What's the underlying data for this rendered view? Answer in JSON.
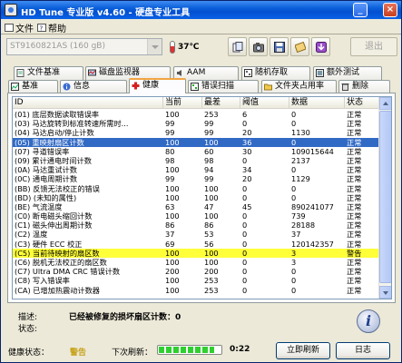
{
  "window": {
    "title": "HD Tune 专业版 v4.60 - 硬盘专业工具"
  },
  "menu": {
    "file": "文件",
    "help": "帮助"
  },
  "toolbar": {
    "disk": "ST9160821AS (160 gB)",
    "temperature": "37℃",
    "exit": "退出"
  },
  "tabs_top": [
    {
      "label": "文件基准",
      "icon": "file-icon"
    },
    {
      "label": "磁盘监视器",
      "icon": "monitor-icon"
    },
    {
      "label": "AAM",
      "icon": "speaker-icon"
    },
    {
      "label": "随机存取",
      "icon": "random-icon"
    },
    {
      "label": "额外测试",
      "icon": "extra-icon"
    }
  ],
  "tabs_bottom": [
    {
      "label": "基准",
      "icon": "benchmark-icon"
    },
    {
      "label": "信息",
      "icon": "info-icon"
    },
    {
      "label": "健康",
      "icon": "health-cross-icon"
    },
    {
      "label": "错误扫描",
      "icon": "scan-icon"
    },
    {
      "label": "文件夹占用率",
      "icon": "folder-icon"
    },
    {
      "label": "删除",
      "icon": "delete-icon"
    }
  ],
  "table": {
    "columns": [
      "ID",
      "当前",
      "最差",
      "阈值",
      "数据",
      "状态"
    ],
    "rows": [
      [
        "(01) 底层数据读取错误率",
        "100",
        "253",
        "6",
        "0",
        "正常"
      ],
      [
        "(03) 马达旋转到标准转速所需时...",
        "99",
        "99",
        "0",
        "0",
        "正常"
      ],
      [
        "(04) 马达启动/停止计数",
        "99",
        "99",
        "20",
        "1130",
        "正常"
      ],
      [
        "(05) 重映射扇区计数",
        "100",
        "100",
        "36",
        "0",
        "正常"
      ],
      [
        "(07) 寻道错误率",
        "80",
        "60",
        "30",
        "109015644",
        "正常"
      ],
      [
        "(09) 累计通电时间计数",
        "98",
        "98",
        "0",
        "2137",
        "正常"
      ],
      [
        "(0A) 马达重试计数",
        "100",
        "94",
        "34",
        "0",
        "正常"
      ],
      [
        "(0C) 通电周期计数",
        "99",
        "99",
        "20",
        "1129",
        "正常"
      ],
      [
        "(BB) 反馈无法校正的错误",
        "100",
        "100",
        "0",
        "0",
        "正常"
      ],
      [
        "(BD) (未知的属性)",
        "100",
        "100",
        "0",
        "0",
        "正常"
      ],
      [
        "(BE) 气流温度",
        "63",
        "47",
        "45",
        "890241077",
        "正常"
      ],
      [
        "(C0) 断电磁头缩回计数",
        "100",
        "100",
        "0",
        "739",
        "正常"
      ],
      [
        "(C1) 磁头伸出周期计数",
        "86",
        "86",
        "0",
        "28188",
        "正常"
      ],
      [
        "(C2) 温度",
        "37",
        "53",
        "0",
        "37",
        "正常"
      ],
      [
        "(C3) 硬件 ECC 校正",
        "69",
        "56",
        "0",
        "120142357",
        "正常"
      ],
      [
        "(C5) 当前待映射的扇区数",
        "100",
        "100",
        "0",
        "3",
        "警告"
      ],
      [
        "(C6) 脱机无法校正的扇区数",
        "100",
        "100",
        "0",
        "3",
        "正常"
      ],
      [
        "(C7) Ultra DMA CRC 错误计数",
        "200",
        "200",
        "0",
        "0",
        "正常"
      ],
      [
        "(C8) 写入错误率",
        "100",
        "253",
        "0",
        "0",
        "正常"
      ],
      [
        "(CA) 已增加热震动计数器",
        "100",
        "253",
        "0",
        "0",
        "正常"
      ]
    ]
  },
  "details": {
    "desc_label": "描述:",
    "desc_value": "已经被修复的损坏扇区计数：0",
    "state_label": "状态:",
    "state_value": ""
  },
  "status": {
    "health_label": "健康状态：",
    "health_value": "警告",
    "refresh_label": "下次刷新：",
    "timer": "0:22",
    "refresh_progress": 0.9,
    "refresh_button": "立即刷新",
    "log_button": "日志"
  },
  "colors": {
    "selected_row": "#316ac5",
    "warning_row": "#ffff3a",
    "warning_text": "#c7a21a"
  }
}
